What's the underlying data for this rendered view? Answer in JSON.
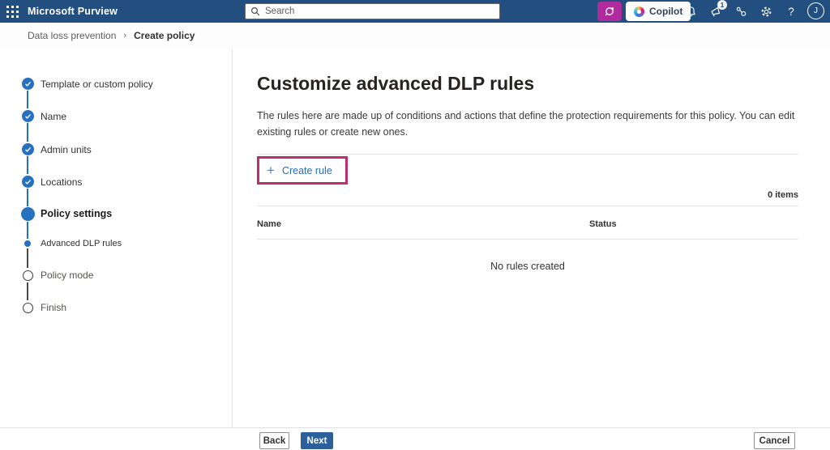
{
  "header": {
    "app_title": "Microsoft Purview",
    "search_placeholder": "Search",
    "copilot_label": "Copilot",
    "notification_badge": "1",
    "help_label": "?",
    "avatar_initial": "J"
  },
  "breadcrumb": {
    "items": [
      "Data loss prevention",
      "Create policy"
    ],
    "separator": "›"
  },
  "wizard": {
    "steps": [
      {
        "label": "Template or custom policy",
        "state": "completed"
      },
      {
        "label": "Name",
        "state": "completed"
      },
      {
        "label": "Admin units",
        "state": "completed"
      },
      {
        "label": "Locations",
        "state": "completed"
      },
      {
        "label": "Policy settings",
        "state": "current"
      },
      {
        "label": "Advanced DLP rules",
        "state": "current-sub"
      },
      {
        "label": "Policy mode",
        "state": "upcoming"
      },
      {
        "label": "Finish",
        "state": "upcoming"
      }
    ]
  },
  "main": {
    "title": "Customize advanced DLP rules",
    "description": "The rules here are made up of conditions and actions that define the protection requirements for this policy. You can edit existing rules or create new ones.",
    "create_rule_label": "Create rule",
    "items_count": "0 items",
    "table": {
      "columns": [
        "Name",
        "Status"
      ],
      "rows": [],
      "empty_message": "No rules created"
    }
  },
  "footer": {
    "back_label": "Back",
    "next_label": "Next",
    "cancel_label": "Cancel"
  },
  "icons": {
    "plus": "+"
  },
  "colors": {
    "header_bg": "#234f80",
    "accent_blue": "#2670c0",
    "link_blue": "#2b6cb8",
    "next_button_blue": "#2d5f9b",
    "highlight_magenta": "#bc2f6f",
    "security_copilot_magenta": "#b02c9e"
  }
}
